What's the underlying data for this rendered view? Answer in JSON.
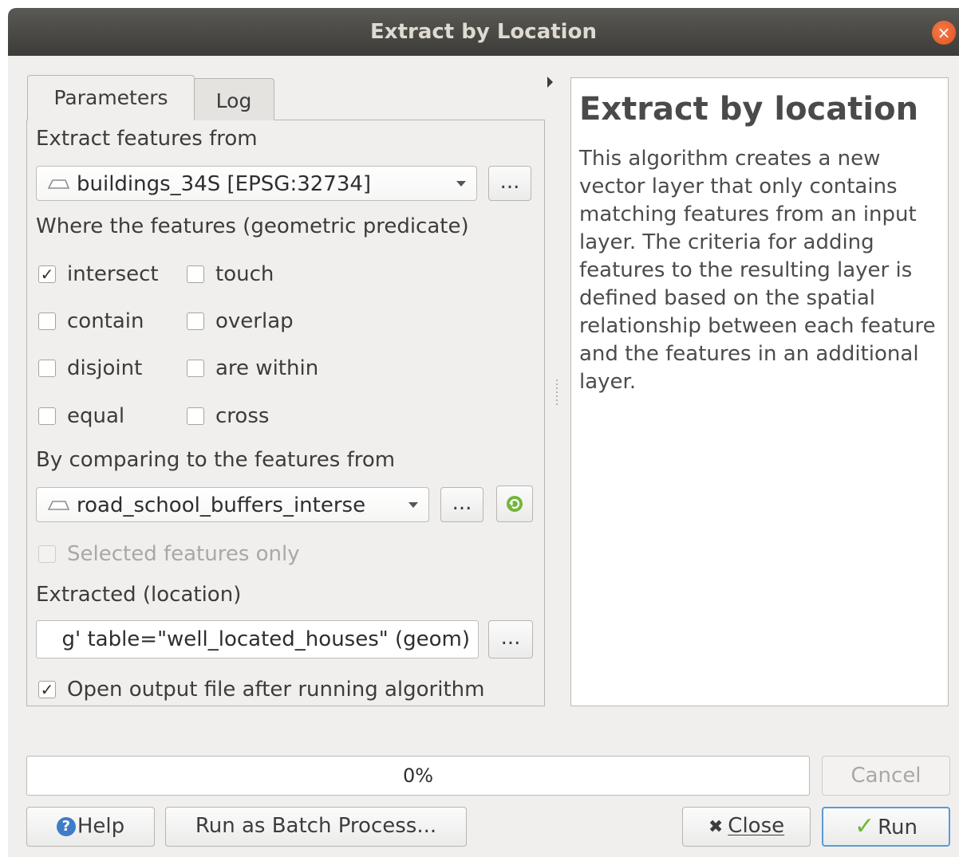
{
  "window": {
    "title": "Extract by Location"
  },
  "tabs": [
    {
      "label": "Parameters",
      "active": true
    },
    {
      "label": "Log",
      "active": false
    }
  ],
  "params": {
    "extract_from_label": "Extract features from",
    "extract_from_value": "buildings_34S [EPSG:32734]",
    "predicate_label": "Where the features (geometric predicate)",
    "predicates": [
      {
        "label": "intersect",
        "checked": true
      },
      {
        "label": "touch",
        "checked": false
      },
      {
        "label": "contain",
        "checked": false
      },
      {
        "label": "overlap",
        "checked": false
      },
      {
        "label": "disjoint",
        "checked": false
      },
      {
        "label": "are within",
        "checked": false
      },
      {
        "label": "equal",
        "checked": false
      },
      {
        "label": "cross",
        "checked": false
      }
    ],
    "compare_label": "By comparing to the features from",
    "compare_value": "road_school_buffers_interse",
    "selected_only_label": "Selected features only",
    "selected_only_checked": false,
    "output_label": "Extracted (location)",
    "output_value": "g' table=\"well_located_houses\" (geom)",
    "open_output_label": "Open output file after running algorithm",
    "open_output_checked": true,
    "browse_label": "...",
    "check_mark": "✓"
  },
  "help": {
    "title": "Extract by location",
    "body": "This algorithm creates a new vector layer that only contains matching features from an input layer. The criteria for adding features to the resulting layer is defined based on the spatial relationship between each feature and the features in an additional layer."
  },
  "progress": {
    "value": 0,
    "text": "0%"
  },
  "buttons": {
    "cancel": "Cancel",
    "help": "Help",
    "batch": "Run as Batch Process...",
    "close": "Close",
    "run": "Run"
  },
  "colors": {
    "titlebar": "#3d3c38",
    "window_bg": "#f0efee",
    "close_circle": "#e2531f",
    "run_icon": "#72b533",
    "help_icon": "#3e7cc7"
  }
}
